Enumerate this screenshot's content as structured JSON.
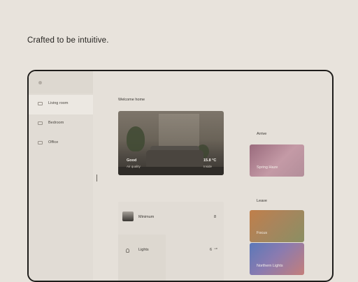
{
  "tagline": "Crafted to be intuitive.",
  "sidebar": {
    "items": [
      {
        "label": "Living room",
        "icon": "sofa-icon",
        "active": true
      },
      {
        "label": "Bedroom",
        "icon": "bed-icon",
        "active": false
      },
      {
        "label": "Office",
        "icon": "desk-icon",
        "active": false
      }
    ]
  },
  "main": {
    "welcome": "Welcome home",
    "hero": {
      "air_value": "Good",
      "air_label": "Air quality",
      "temp_value": "15.8 °C",
      "temp_label": "Inside"
    },
    "devices": [
      {
        "label": "Minimum",
        "value": "8"
      },
      {
        "label": "Lights",
        "value": "6"
      }
    ]
  },
  "scenes": [
    {
      "label": "Arrive",
      "color": "#ebe7e1"
    },
    {
      "label": "Spring Haze",
      "color": "#b88a98"
    },
    {
      "label": "Leave",
      "color": "#ebe7e1"
    },
    {
      "label": "Focus",
      "color": "#a58565"
    },
    {
      "label": "Northern Lights",
      "color": "#6c7fb5"
    }
  ]
}
